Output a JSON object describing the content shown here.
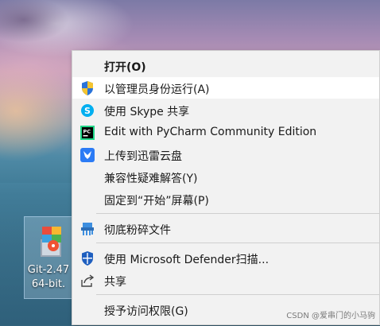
{
  "desktop": {
    "icon": {
      "name": "git-installer-icon",
      "label": "Git-2.47\n64-bit."
    }
  },
  "context_menu": {
    "items": [
      {
        "id": "open",
        "label": "打开(O)",
        "bold": true,
        "icon": ""
      },
      {
        "id": "run-as-admin",
        "label": "以管理员身份运行(A)",
        "icon": "uac-shield-icon",
        "highlighted": true
      },
      {
        "id": "share-skype",
        "label": "使用 Skype 共享",
        "icon": "skype-icon"
      },
      {
        "id": "pycharm",
        "label": "Edit with PyCharm Community Edition",
        "icon": "pycharm-icon"
      },
      {
        "id": "xunlei",
        "label": "上传到迅雷云盘",
        "icon": "xunlei-icon"
      },
      {
        "id": "compat",
        "label": "兼容性疑难解答(Y)",
        "icon": ""
      },
      {
        "id": "pin-start",
        "label": "固定到“开始”屏幕(P)",
        "icon": ""
      },
      {
        "id": "shred",
        "label": "彻底粉碎文件",
        "icon": "shredder-icon"
      },
      {
        "id": "defender",
        "label": "使用 Microsoft Defender扫描...",
        "icon": "defender-icon"
      },
      {
        "id": "share",
        "label": "共享",
        "icon": "share-icon"
      },
      {
        "id": "grant-access",
        "label": "授予访问权限(G)",
        "icon": ""
      }
    ]
  },
  "watermark": "CSDN @爱串门的小马驹",
  "colors": {
    "menu_bg": "#f2f2f2",
    "hover_bg": "#ffffff",
    "separator": "#cfcfcf",
    "skype_blue": "#00aff0",
    "xunlei_blue": "#2b7bf5",
    "defender_blue": "#1f5fbf"
  }
}
